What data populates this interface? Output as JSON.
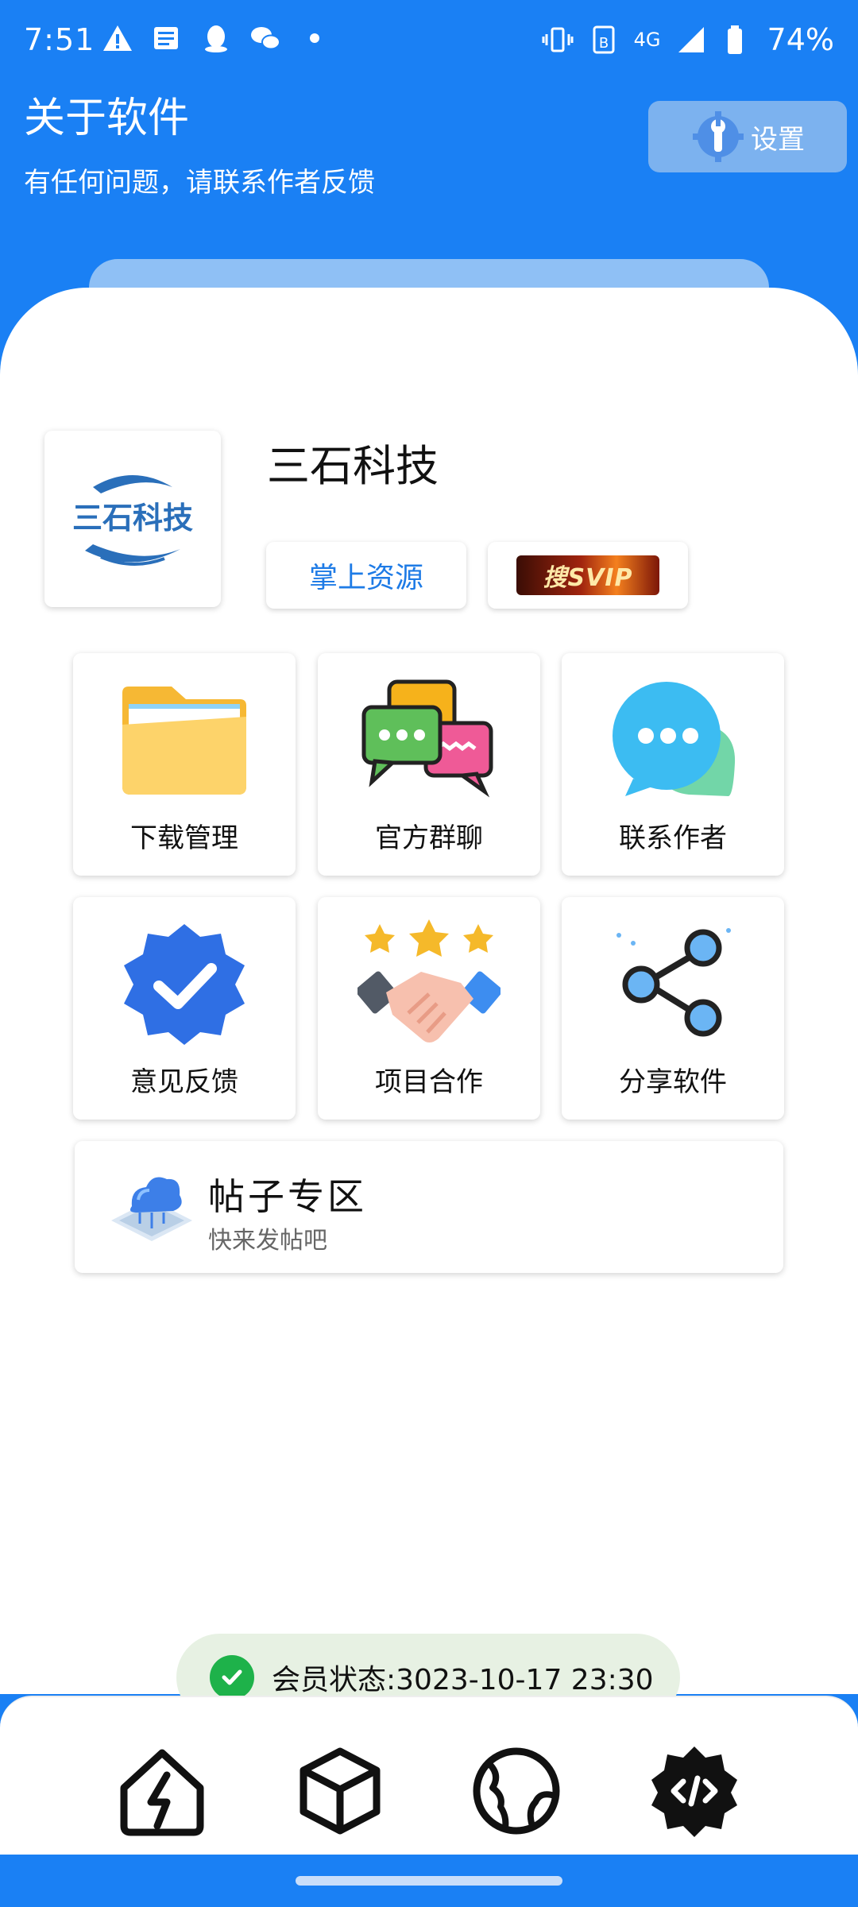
{
  "status_bar": {
    "time": "7:51",
    "network": "4G",
    "battery": "74%"
  },
  "header": {
    "title": "关于软件",
    "subtitle": "有任何问题，请联系作者反馈",
    "settings_label": "设置"
  },
  "company": {
    "name": "三石科技",
    "logo_text": "三石科技",
    "resource_button": "掌上资源",
    "svip_badge": "搜SVIP"
  },
  "tiles": [
    {
      "label": "下载管理",
      "icon": "folder-icon"
    },
    {
      "label": "官方群聊",
      "icon": "chat-bubbles-icon"
    },
    {
      "label": "联系作者",
      "icon": "message-icon"
    },
    {
      "label": "意见反馈",
      "icon": "verified-badge-icon"
    },
    {
      "label": "项目合作",
      "icon": "handshake-icon"
    },
    {
      "label": "分享软件",
      "icon": "share-icon"
    }
  ],
  "posts": {
    "title": "帖子专区",
    "subtitle": "快来发帖吧"
  },
  "membership": {
    "text": "会员状态:3023-10-17 23:30"
  },
  "bottom_nav": [
    {
      "icon": "home-bolt-icon"
    },
    {
      "icon": "cube-icon"
    },
    {
      "icon": "globe-icon"
    },
    {
      "icon": "code-gear-icon"
    }
  ],
  "colors": {
    "brand_blue": "#1a80f4",
    "accent_text": "#1e7be6",
    "success_green": "#1eb24a"
  }
}
